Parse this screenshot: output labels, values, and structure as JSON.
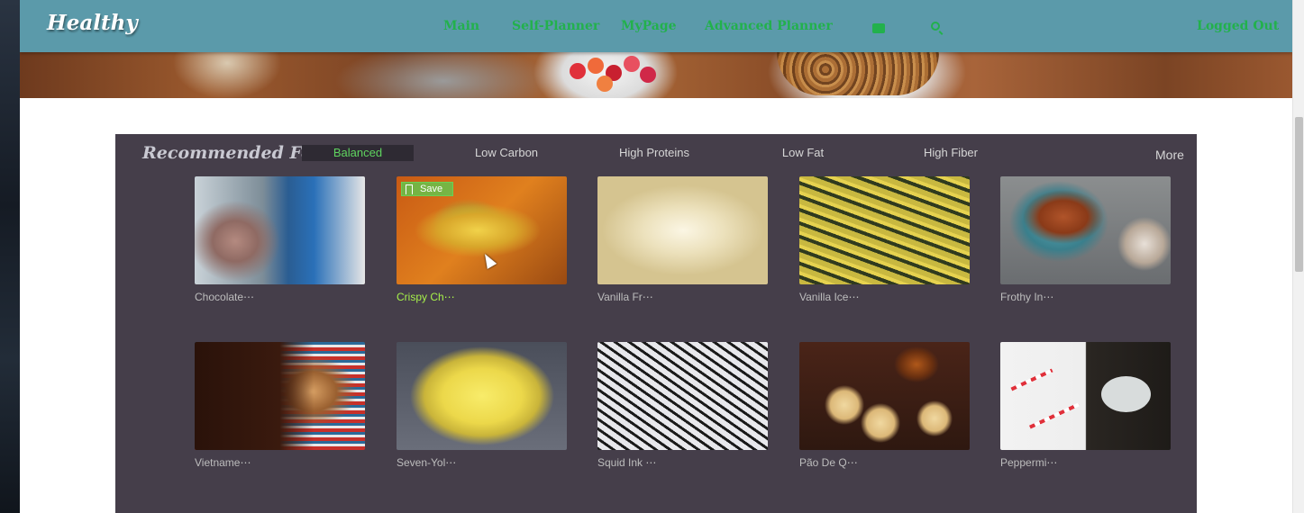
{
  "navbar": {
    "logo": "Healthy",
    "links": [
      "Main",
      "Self-Planner",
      "MyPage",
      "Advanced Planner"
    ],
    "cart_icon": "cart-icon",
    "search_icon": "search-icon",
    "logout": "Logged Out"
  },
  "recommended": {
    "title": "Recommended Food",
    "tabs": [
      "Balanced",
      "Low Carbon",
      "High Proteins",
      "Low Fat",
      "High Fiber"
    ],
    "active_tab": "Balanced",
    "more": "More",
    "save_label": "Save",
    "foods": [
      {
        "name": "Chocolate⋯"
      },
      {
        "name": "Crispy Ch⋯"
      },
      {
        "name": "Vanilla Fr⋯"
      },
      {
        "name": "Vanilla Ice⋯"
      },
      {
        "name": "Frothy In⋯"
      },
      {
        "name": "Vietname⋯"
      },
      {
        "name": "Seven-Yol⋯"
      },
      {
        "name": "Squid Ink ⋯"
      },
      {
        "name": "Pão De Q⋯"
      },
      {
        "name": "Peppermi⋯"
      }
    ]
  },
  "colors": {
    "navbar": "#5b9aaa",
    "nav_link": "#22b14c",
    "panel": "#453e4a",
    "active_tab_text": "#5fd45f",
    "highlight_name": "#a6f04a"
  }
}
